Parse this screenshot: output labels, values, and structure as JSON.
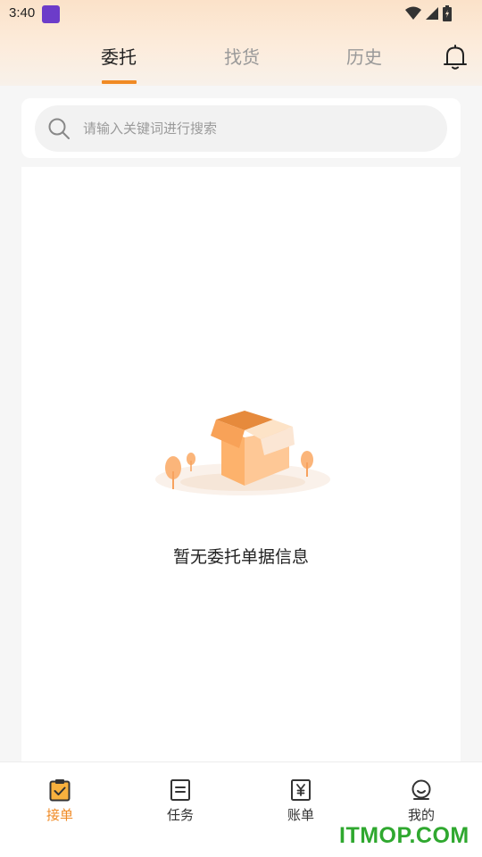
{
  "status_bar": {
    "time": "3:40"
  },
  "tabs": [
    {
      "label": "委托",
      "active": true
    },
    {
      "label": "找货",
      "active": false
    },
    {
      "label": "历史",
      "active": false
    }
  ],
  "search": {
    "placeholder": "请输入关键词进行搜索",
    "value": ""
  },
  "empty_state": {
    "message": "暂无委托单据信息"
  },
  "bottom_nav": [
    {
      "label": "接单",
      "icon": "clipboard-check-icon",
      "active": true
    },
    {
      "label": "任务",
      "icon": "list-doc-icon",
      "active": false
    },
    {
      "label": "账单",
      "icon": "yen-doc-icon",
      "active": false
    },
    {
      "label": "我的",
      "icon": "user-icon",
      "active": false
    }
  ],
  "watermark": "ITMOP.COM",
  "colors": {
    "accent": "#f08a24",
    "watermark": "#2fa82f"
  }
}
